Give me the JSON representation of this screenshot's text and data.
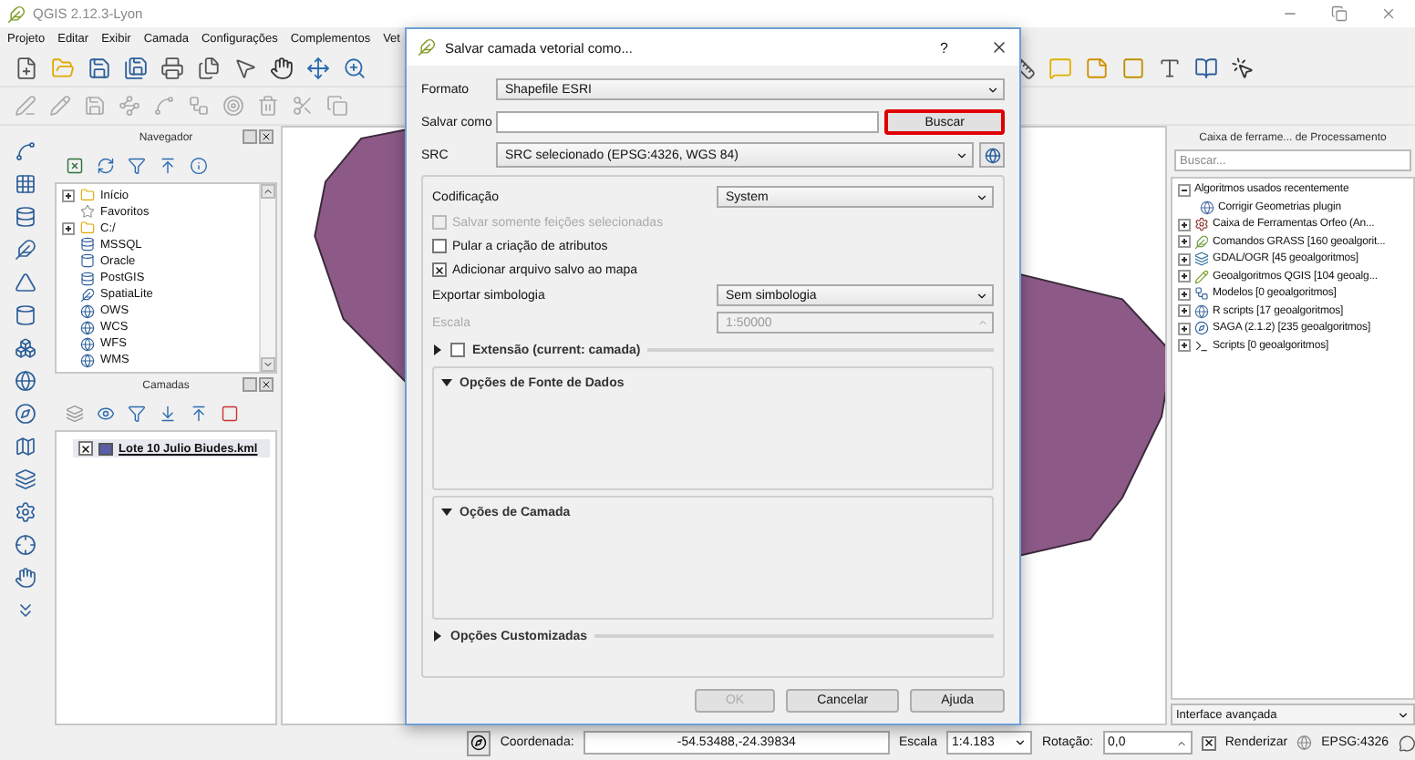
{
  "app": {
    "title": "QGIS 2.12.3-Lyon"
  },
  "menu": [
    "Projeto",
    "Editar",
    "Exibir",
    "Camada",
    "Configurações",
    "Complementos",
    "Vet"
  ],
  "navigator": {
    "title": "Navegador",
    "items": [
      {
        "label": "Início",
        "kind": "folder",
        "expandable": true
      },
      {
        "label": "Favoritos",
        "kind": "favorites",
        "expandable": false
      },
      {
        "label": "C:/",
        "kind": "folder",
        "expandable": true
      },
      {
        "label": "MSSQL",
        "kind": "database",
        "expandable": false
      },
      {
        "label": "Oracle",
        "kind": "oracle",
        "expandable": false
      },
      {
        "label": "PostGIS",
        "kind": "database",
        "expandable": false
      },
      {
        "label": "SpatiaLite",
        "kind": "spatialite",
        "expandable": false
      },
      {
        "label": "OWS",
        "kind": "service",
        "expandable": false
      },
      {
        "label": "WCS",
        "kind": "service",
        "expandable": false
      },
      {
        "label": "WFS",
        "kind": "service",
        "expandable": false
      },
      {
        "label": "WMS",
        "kind": "service",
        "expandable": false
      }
    ]
  },
  "layers": {
    "title": "Camadas",
    "items": [
      {
        "name": "Lote 10 Julio Biudes.kml",
        "visible": true,
        "selected": true,
        "color": "#5b5ea6"
      }
    ]
  },
  "processing": {
    "title": "Caixa de ferrame... de Processamento",
    "search": {
      "placeholder": "Buscar..."
    },
    "tree": [
      {
        "label": "Algoritmos usados recentemente",
        "kind": "group",
        "expanded": true,
        "children": [
          {
            "label": "Corrigir Geometrias plugin",
            "kind": "r"
          }
        ]
      },
      {
        "label": "Caixa de Ferramentas Orfeo (An...",
        "kind": "orfeo",
        "expanded": false
      },
      {
        "label": "Comandos GRASS [160 geoalgorit...",
        "kind": "grass",
        "expanded": false
      },
      {
        "label": "GDAL/OGR [45 geoalgoritmos]",
        "kind": "gdal",
        "expanded": false
      },
      {
        "label": "Geoalgoritmos QGIS [104 geoalg...",
        "kind": "qgis",
        "expanded": false
      },
      {
        "label": "Modelos [0 geoalgoritmos]",
        "kind": "models",
        "expanded": false
      },
      {
        "label": "R scripts [17 geoalgoritmos]",
        "kind": "r",
        "expanded": false
      },
      {
        "label": "SAGA (2.1.2) [235 geoalgoritmos]",
        "kind": "saga",
        "expanded": false
      },
      {
        "label": "Scripts [0 geoalgoritmos]",
        "kind": "scripts",
        "expanded": false
      }
    ],
    "mode": "Interface avançada"
  },
  "dialog": {
    "title": "Salvar camada vetorial como...",
    "help": "?",
    "format": {
      "label": "Formato",
      "value": "Shapefile ESRI"
    },
    "save_as": {
      "label": "Salvar como",
      "button": "Buscar",
      "highlighted": true
    },
    "crs": {
      "label": "SRC",
      "value": "SRC selecionado (EPSG:4326, WGS 84)"
    },
    "encoding": {
      "label": "Codificação",
      "value": "System"
    },
    "options": [
      {
        "label": "Salvar somente feições selecionadas",
        "checked": false,
        "disabled": true
      },
      {
        "label": "Pular a criação de atributos",
        "checked": false,
        "disabled": false
      },
      {
        "label": "Adicionar arquivo salvo ao mapa",
        "checked": true,
        "disabled": false
      }
    ],
    "symbology": {
      "label": "Exportar simbologia",
      "value": "Sem simbologia"
    },
    "scale": {
      "label": "Escala",
      "value": "1:50000",
      "disabled": true
    },
    "sections": [
      {
        "title": "Extensão (current: camada)",
        "kind": "checkable",
        "expanded": false,
        "checked": false
      },
      {
        "title": "Opções de Fonte de Dados",
        "kind": "plain",
        "expanded": true
      },
      {
        "title": "Oções de Camada",
        "kind": "plain",
        "expanded": true
      },
      {
        "title": "Opções Customizadas",
        "kind": "plain",
        "expanded": false
      }
    ],
    "buttons": [
      {
        "label": "OK",
        "disabled": true
      },
      {
        "label": "Cancelar",
        "disabled": false
      },
      {
        "label": "Ajuda",
        "disabled": false
      }
    ]
  },
  "status_bar": {
    "coordinate_label": "Coordenada:",
    "coordinate": "-54.53488,-24.39834",
    "scale_label": "Escala",
    "scale": "1:4.183",
    "rotation_label": "Rotação:",
    "rotation": "0,0",
    "render": {
      "label": "Renderizar",
      "checked": true
    },
    "crs": "EPSG:4326"
  }
}
